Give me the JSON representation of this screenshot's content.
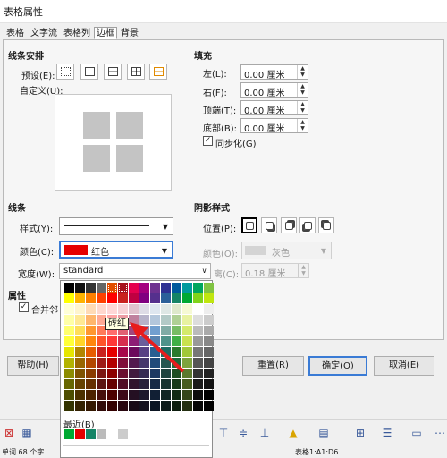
{
  "dialog": {
    "title": "表格属性"
  },
  "tabs": [
    "表格",
    "文字流",
    "表格列",
    "边框",
    "背景"
  ],
  "line_arrangement": {
    "heading": "线条安排",
    "presets_label": "预设(E):",
    "custom_label": "自定义(U):"
  },
  "padding": {
    "heading": "填充",
    "fields": [
      {
        "label": "左(L):",
        "value": "0.00 厘米"
      },
      {
        "label": "右(F):",
        "value": "0.00 厘米"
      },
      {
        "label": "顶端(T):",
        "value": "0.00 厘米"
      },
      {
        "label": "底部(B):",
        "value": "0.00 厘米"
      }
    ],
    "sync_label": "同步化(G)",
    "sync_checked": "✓"
  },
  "line": {
    "heading": "线条",
    "style_label": "样式(Y):",
    "color_label": "颜色(C):",
    "color_value": "红色",
    "color_swatch": "#e60000",
    "width_label": "宽度(W):",
    "width_value": "standard"
  },
  "shadow": {
    "heading": "阴影样式",
    "position_label": "位置(P):",
    "color_label": "颜色(O):",
    "color_value": "灰色",
    "distance_suffix": "离(C):",
    "distance_value": "0.18 厘米"
  },
  "properties": {
    "heading": "属性",
    "merge_label": "合并邻"
  },
  "buttons": {
    "help": "帮助(H)",
    "reset": "重置(R)",
    "ok": "确定(O)",
    "cancel": "取消(E)"
  },
  "palette": {
    "tooltip": "砖红",
    "recent_label": "最近(B)",
    "colors": [
      "#000000",
      "#111111",
      "#333333",
      "#666666",
      "#e14d00",
      "#a6121e",
      "#e5004f",
      "#a3007f",
      "#6e3290",
      "#2e3192",
      "#00599d",
      "#009a9d",
      "#00a65e",
      "#80c342",
      "#ffff00",
      "#ffb300",
      "#ff8000",
      "#ff4000",
      "#ff0000",
      "#c9211e",
      "#bf0041",
      "#800080",
      "#55308d",
      "#2a6099",
      "#158466",
      "#00a933",
      "#81d41a",
      "#c0e60f",
      "#ffffd7",
      "#fff5ce",
      "#ffdbb6",
      "#ffd8ce",
      "#ffd7d7",
      "#f7d1d5",
      "#e0c2cd",
      "#dedce6",
      "#dee6ef",
      "#dee7e5",
      "#dde8cb",
      "#f6f9d4",
      "#ffffff",
      "#eeeeee",
      "#ffffa6",
      "#ffe994",
      "#ffb66c",
      "#ffaa95",
      "#ffa6a6",
      "#ec9ba4",
      "#bf819e",
      "#b7b3ca",
      "#b4c7dc",
      "#b3cac7",
      "#afd095",
      "#e8f2a1",
      "#dddddd",
      "#cccccc",
      "#ffff6d",
      "#ffde59",
      "#ff972f",
      "#ff7b59",
      "#ff6d6d",
      "#e16173",
      "#a1467e",
      "#8e86ae",
      "#729fcf",
      "#81aca6",
      "#77bc65",
      "#d4ea6b",
      "#bbbbbb",
      "#aaaaaa",
      "#ffff38",
      "#ffd428",
      "#ff860d",
      "#ff5429",
      "#ff3838",
      "#d62e4e",
      "#8d1d75",
      "#6b5e9b",
      "#5983b0",
      "#50938a",
      "#3faf46",
      "#c9e24f",
      "#999999",
      "#888888",
      "#e6e600",
      "#b28600",
      "#e65c00",
      "#c9211e",
      "#e60000",
      "#a7074b",
      "#6c0a5c",
      "#584183",
      "#2a5f91",
      "#1f6c63",
      "#2a7a2c",
      "#a1c83a",
      "#777777",
      "#666666",
      "#b2b200",
      "#996600",
      "#b34700",
      "#9e1b17",
      "#b30000",
      "#800d3a",
      "#521a4f",
      "#46376b",
      "#214a7a",
      "#255650",
      "#1e6a39",
      "#7da33d",
      "#555555",
      "#444444",
      "#8c8c00",
      "#7f5200",
      "#8a3b00",
      "#7b1712",
      "#8c0000",
      "#6b0f30",
      "#411a3e",
      "#352a53",
      "#1d3862",
      "#1e433f",
      "#1d4d21",
      "#5c7a2e",
      "#333333",
      "#222222",
      "#666600",
      "#664100",
      "#662f00",
      "#5c1410",
      "#660000",
      "#510c24",
      "#30142d",
      "#27203c",
      "#162946",
      "#16322f",
      "#163818",
      "#465c1f",
      "#1a1a1a",
      "#111111",
      "#4d4d00",
      "#4d3100",
      "#4d2300",
      "#470f0b",
      "#4d0000",
      "#3d0918",
      "#240f22",
      "#1c182c",
      "#111f34",
      "#102523",
      "#102a13",
      "#344519",
      "#0d0d0d",
      "#000000",
      "#333300",
      "#332100",
      "#331700",
      "#300a08",
      "#330000",
      "#29060f",
      "#180a16",
      "#13101d",
      "#0b1522",
      "#0b1918",
      "#0b1c0d",
      "#232e10",
      "#060606",
      "#000000"
    ],
    "recent": [
      "#00a933",
      "#e60000",
      "#158466",
      "#bbbbbb",
      "#ffffff",
      "#cccccc"
    ]
  },
  "statusbar": {
    "words": "单词  68 个字",
    "table_ref": "表格1:A1:D6"
  }
}
